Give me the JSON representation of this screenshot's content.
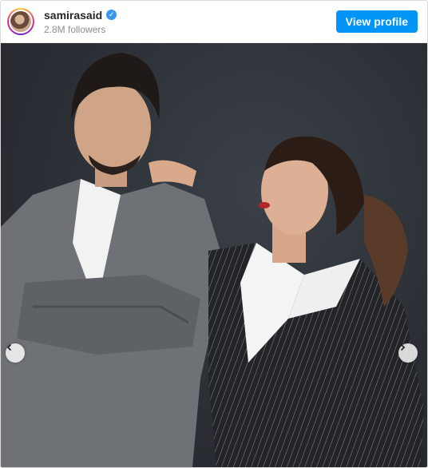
{
  "header": {
    "username": "samirasaid",
    "verified_icon": "verified-badge-icon",
    "followers": "2.8M followers",
    "view_profile_label": "View profile"
  },
  "carousel": {
    "prev_icon": "chevron-left-icon",
    "next_icon": "chevron-right-icon"
  },
  "colors": {
    "accent": "#0095f6",
    "verified": "#3897f0",
    "photo_background": "#2c3036"
  }
}
